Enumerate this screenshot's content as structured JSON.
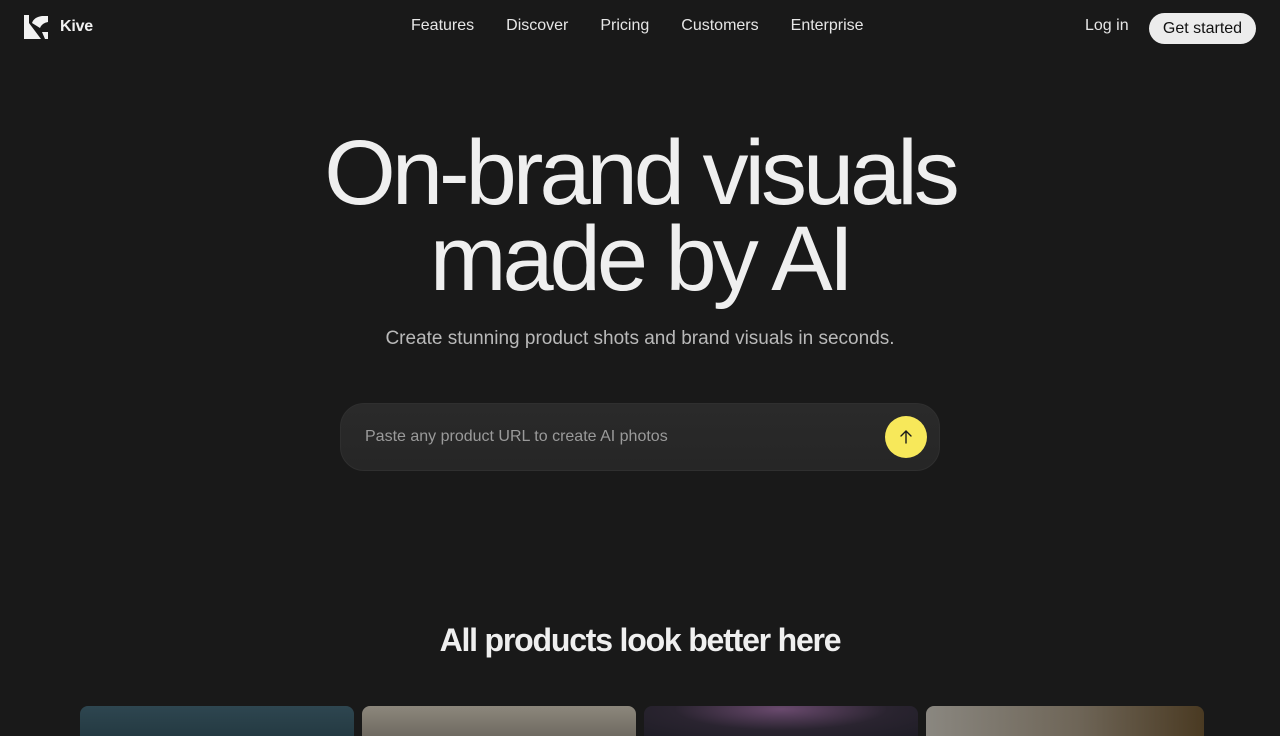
{
  "nav": {
    "brand": "Kive",
    "links": [
      "Features",
      "Discover",
      "Pricing",
      "Customers",
      "Enterprise"
    ],
    "login": "Log in",
    "cta": "Get started"
  },
  "hero": {
    "title_line1": "On-brand visuals",
    "title_line2": "made by AI",
    "subtitle": "Create stunning product shots and brand visuals in seconds.",
    "url_placeholder": "Paste any product URL to create AI photos",
    "url_value": "",
    "submit_icon": "arrow-up-icon",
    "submit_color": "#f7e85a"
  },
  "products": {
    "title": "All products look better here"
  }
}
